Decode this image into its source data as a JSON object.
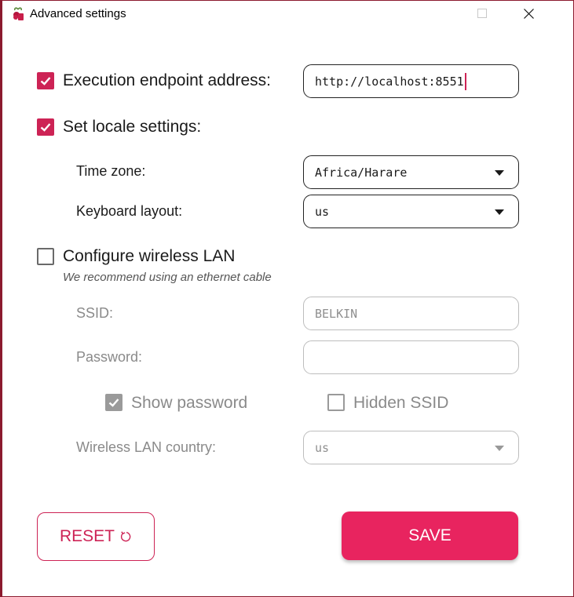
{
  "window": {
    "title": "Advanced settings",
    "minimize_icon": "minimize-icon",
    "maximize_icon": "maximize-icon",
    "close_icon": "close-icon"
  },
  "execution": {
    "checked": true,
    "label": "Execution endpoint address:",
    "value": "http://localhost:8551"
  },
  "locale": {
    "checked": true,
    "label": "Set locale settings:",
    "timezone_label": "Time zone:",
    "timezone_value": "Africa/Harare",
    "keyboard_label": "Keyboard layout:",
    "keyboard_value": "us"
  },
  "wireless": {
    "checked": false,
    "label": "Configure wireless LAN",
    "hint": "We recommend using an ethernet cable",
    "ssid_label": "SSID:",
    "ssid_placeholder": "BELKIN",
    "password_label": "Password:",
    "password_value": "",
    "show_password_label": "Show password",
    "show_password_checked": true,
    "hidden_ssid_label": "Hidden SSID",
    "hidden_ssid_checked": false,
    "country_label": "Wireless LAN country:",
    "country_value": "us"
  },
  "buttons": {
    "reset_label": "RESET",
    "reset_icon": "reset-icon",
    "save_label": "SAVE"
  },
  "colors": {
    "accent": "#cd2355",
    "save_button": "#e8245f",
    "window_border": "#8b1a2e"
  }
}
